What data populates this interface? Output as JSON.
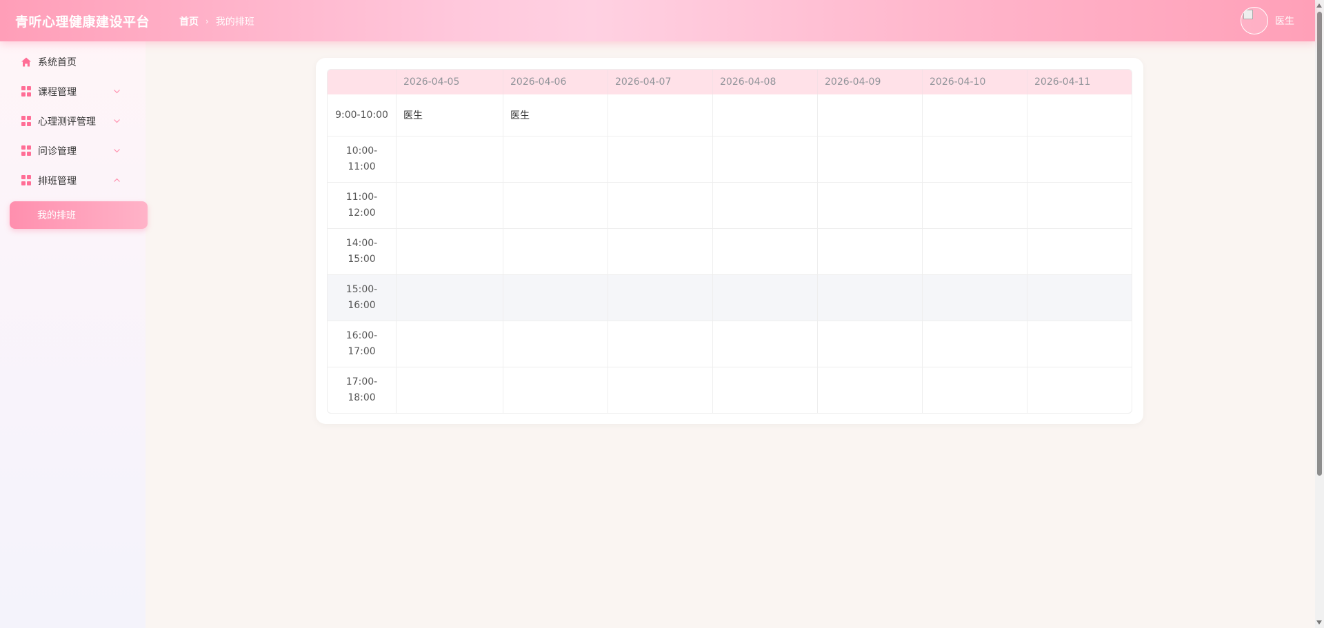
{
  "header": {
    "title": "青听心理健康建设平台",
    "breadcrumb": {
      "home": "首页",
      "separator": "›",
      "current": "我的排班"
    },
    "user": {
      "name": "医生"
    }
  },
  "sidebar": {
    "items": [
      {
        "label": "系统首页",
        "icon": "home-icon"
      },
      {
        "label": "课程管理",
        "icon": "grid-icon",
        "expanded": false
      },
      {
        "label": "心理测评管理",
        "icon": "grid-icon",
        "expanded": false
      },
      {
        "label": "问诊管理",
        "icon": "grid-icon",
        "expanded": false
      },
      {
        "label": "排班管理",
        "icon": "grid-icon",
        "expanded": true
      }
    ],
    "submenu": {
      "label": "我的排班",
      "active": true
    }
  },
  "schedule": {
    "dates": [
      "2026-04-05",
      "2026-04-06",
      "2026-04-07",
      "2026-04-08",
      "2026-04-09",
      "2026-04-10",
      "2026-04-11"
    ],
    "rows": [
      {
        "time": "9:00-10:00",
        "cells": [
          "医生",
          "医生",
          "",
          "",
          "",
          "",
          ""
        ]
      },
      {
        "time": "10:00-11:00",
        "cells": [
          "",
          "",
          "",
          "",
          "",
          "",
          ""
        ]
      },
      {
        "time": "11:00-12:00",
        "cells": [
          "",
          "",
          "",
          "",
          "",
          "",
          ""
        ]
      },
      {
        "time": "14:00-15:00",
        "cells": [
          "",
          "",
          "",
          "",
          "",
          "",
          ""
        ]
      },
      {
        "time": "15:00-16:00",
        "cells": [
          "",
          "",
          "",
          "",
          "",
          "",
          ""
        ]
      },
      {
        "time": "16:00-17:00",
        "cells": [
          "",
          "",
          "",
          "",
          "",
          "",
          ""
        ]
      },
      {
        "time": "17:00-18:00",
        "cells": [
          "",
          "",
          "",
          "",
          "",
          "",
          ""
        ]
      }
    ]
  },
  "colors": {
    "accent": "#ff6e96",
    "header_bg": "#ffc8dc",
    "table_header_bg": "#ffe1e8",
    "page_bg": "#faf5f2"
  }
}
